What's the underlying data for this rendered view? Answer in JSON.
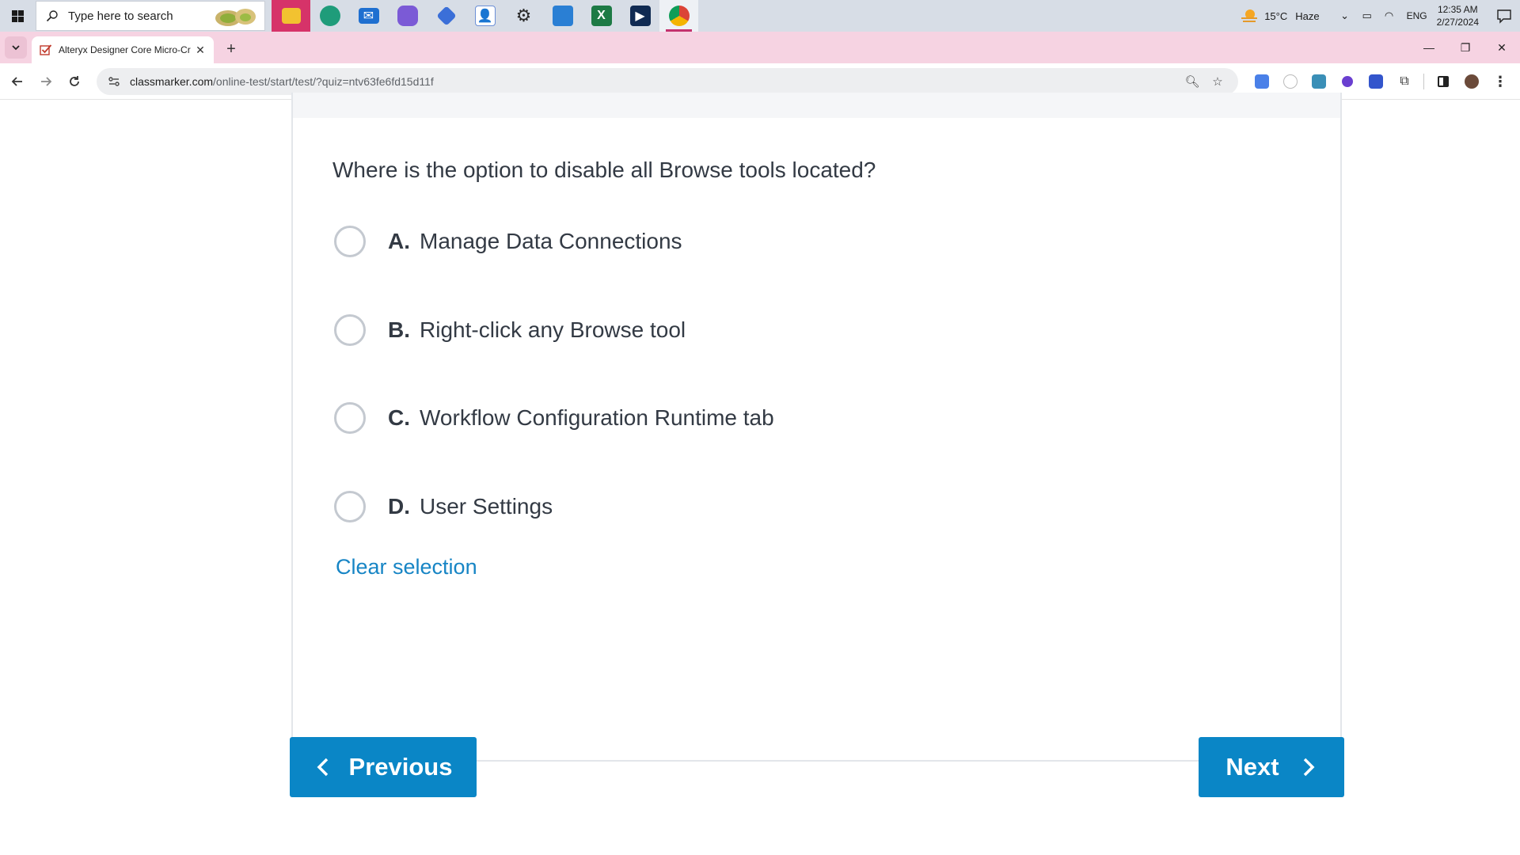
{
  "taskbar": {
    "search_placeholder": "Type here to search",
    "apps": [
      "file-explorer",
      "edge",
      "mail",
      "copilot",
      "flow",
      "contacts",
      "settings",
      "photos",
      "excel",
      "powershell",
      "chrome"
    ],
    "weather_temp": "15°C",
    "weather_desc": "Haze",
    "language": "ENG",
    "time": "12:35 AM",
    "date": "2/27/2024"
  },
  "browser": {
    "tab_title": "Alteryx Designer Core Micro-Cr",
    "url_host": "classmarker.com",
    "url_path": "/online-test/start/test/?quiz=ntv63fe6fd15d11f",
    "accent": "#f6d3e2"
  },
  "question": {
    "text": "Where is the option to disable all Browse tools located?",
    "options": [
      {
        "letter": "A.",
        "text": "Manage Data Connections"
      },
      {
        "letter": "B.",
        "text": "Right-click any Browse tool"
      },
      {
        "letter": "C.",
        "text": "Workflow Configuration Runtime tab"
      },
      {
        "letter": "D.",
        "text": "User Settings"
      }
    ],
    "clear_label": "Clear selection"
  },
  "navigation": {
    "previous_label": "Previous",
    "next_label": "Next",
    "button_color": "#0a86c6"
  }
}
